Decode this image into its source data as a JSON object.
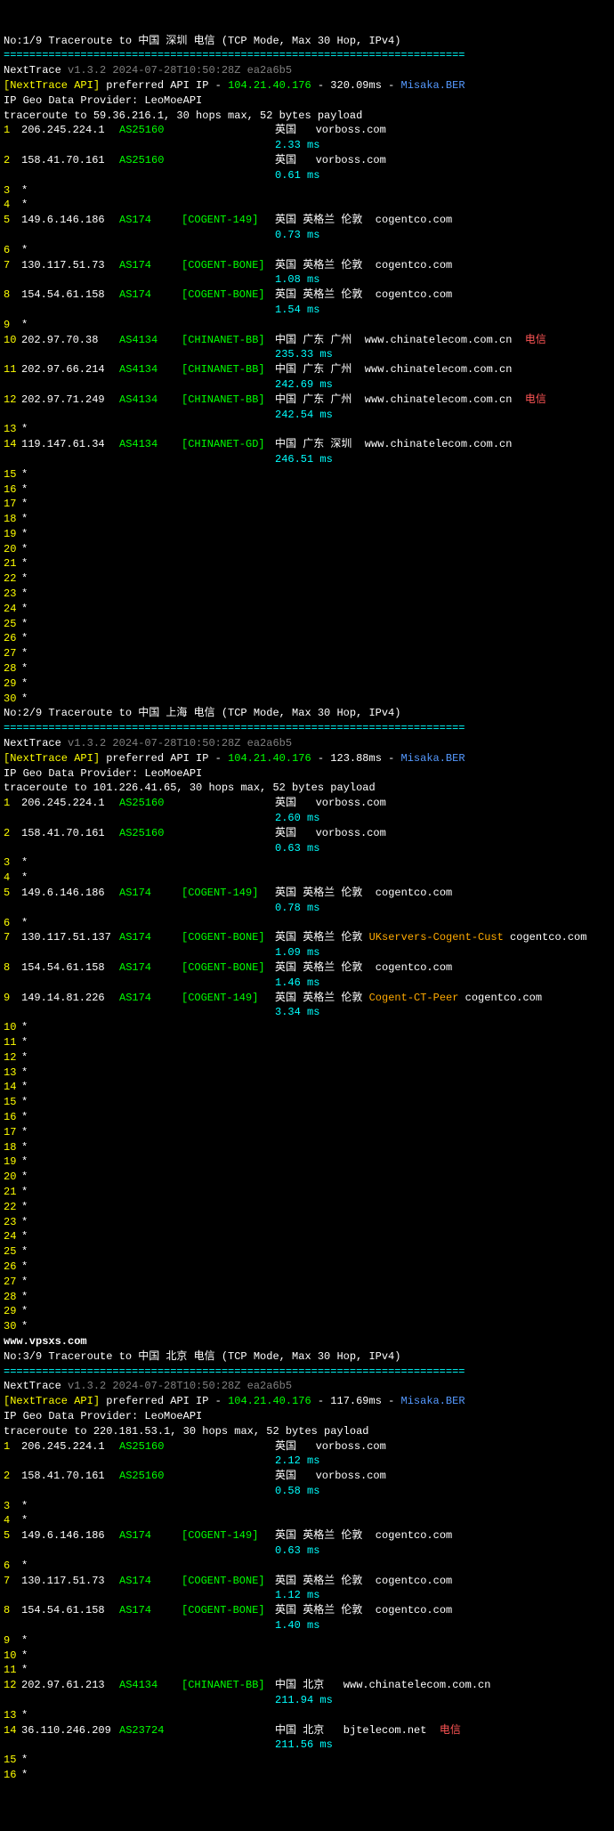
{
  "sections": [
    {
      "title": "No:1/9 Traceroute to 中国 深圳 电信 (TCP Mode, Max 30 Hop, IPv4)",
      "sep": "========================================================================",
      "nexttrace": "NextTrace",
      "ver": "v1.3.2 2024-07-28T10:50:28Z ea2a6b5",
      "api1": "[NextTrace API]",
      "api2": " preferred API IP - ",
      "ip": "104.21.40.176",
      "rtt": " - 320.09ms - ",
      "pop": "Misaka.BER",
      "geo": "IP Geo Data Provider: LeoMoeAPI",
      "trace": "traceroute to 59.36.216.1, 30 hops max, 52 bytes payload",
      "hops": [
        {
          "n": "1",
          "ip": "206.245.224.1",
          "as": "AS25160",
          "net": "",
          "loc": "英国  ",
          "host": " vorboss.com",
          "ms": "2.33 ms"
        },
        {
          "n": "2",
          "ip": "158.41.70.161",
          "as": "AS25160",
          "net": "",
          "loc": "英国  ",
          "host": " vorboss.com",
          "ms": "0.61 ms"
        },
        {
          "n": "3",
          "star": "*"
        },
        {
          "n": "4",
          "star": "*"
        },
        {
          "n": "5",
          "ip": "149.6.146.186",
          "as": "AS174",
          "net": "[COGENT-149]",
          "loc": "英国 英格兰 伦敦 ",
          "host": " cogentco.com",
          "ms": "0.73 ms"
        },
        {
          "n": "6",
          "star": "*"
        },
        {
          "n": "7",
          "ip": "130.117.51.73",
          "as": "AS174",
          "net": "[COGENT-BONE]",
          "loc": "英国 英格兰 伦敦 ",
          "host": " cogentco.com",
          "ms": "1.08 ms"
        },
        {
          "n": "8",
          "ip": "154.54.61.158",
          "as": "AS174",
          "net": "[COGENT-BONE]",
          "loc": "英国 英格兰 伦敦 ",
          "host": " cogentco.com",
          "ms": "1.54 ms"
        },
        {
          "n": "9",
          "star": "*"
        },
        {
          "n": "10",
          "ip": "202.97.70.38",
          "as": "AS4134",
          "net": "[CHINANET-BB]",
          "loc": "中国 广东 广州 ",
          "host": " www.chinatelecom.com.cn",
          "isp": "  电信",
          "ms": "235.33 ms"
        },
        {
          "n": "11",
          "ip": "202.97.66.214",
          "as": "AS4134",
          "net": "[CHINANET-BB]",
          "loc": "中国 广东 广州 ",
          "host": " www.chinatelecom.com.cn",
          "ms": "242.69 ms"
        },
        {
          "n": "12",
          "ip": "202.97.71.249",
          "as": "AS4134",
          "net": "[CHINANET-BB]",
          "loc": "中国 广东 广州 ",
          "host": " www.chinatelecom.com.cn",
          "isp": "  电信",
          "ms": "242.54 ms"
        },
        {
          "n": "13",
          "star": "*"
        },
        {
          "n": "14",
          "ip": "119.147.61.34",
          "as": "AS4134",
          "net": "[CHINANET-GD]",
          "loc": "中国 广东 深圳 ",
          "host": " www.chinatelecom.com.cn",
          "ms": "246.51 ms"
        },
        {
          "n": "15",
          "star": "*"
        },
        {
          "n": "16",
          "star": "*"
        },
        {
          "n": "17",
          "star": "*"
        },
        {
          "n": "18",
          "star": "*"
        },
        {
          "n": "19",
          "star": "*"
        },
        {
          "n": "20",
          "star": "*"
        },
        {
          "n": "21",
          "star": "*"
        },
        {
          "n": "22",
          "star": "*"
        },
        {
          "n": "23",
          "star": "*"
        },
        {
          "n": "24",
          "star": "*"
        },
        {
          "n": "25",
          "star": "*"
        },
        {
          "n": "26",
          "star": "*"
        },
        {
          "n": "27",
          "star": "*"
        },
        {
          "n": "28",
          "star": "*"
        },
        {
          "n": "29",
          "star": "*"
        },
        {
          "n": "30",
          "star": "*"
        }
      ]
    },
    {
      "title": "No:2/9 Traceroute to 中国 上海 电信 (TCP Mode, Max 30 Hop, IPv4)",
      "sep": "========================================================================",
      "nexttrace": "NextTrace",
      "ver": "v1.3.2 2024-07-28T10:50:28Z ea2a6b5",
      "api1": "[NextTrace API]",
      "api2": " preferred API IP - ",
      "ip": "104.21.40.176",
      "rtt": " - 123.88ms - ",
      "pop": "Misaka.BER",
      "geo": "IP Geo Data Provider: LeoMoeAPI",
      "trace": "traceroute to 101.226.41.65, 30 hops max, 52 bytes payload",
      "hops": [
        {
          "n": "1",
          "ip": "206.245.224.1",
          "as": "AS25160",
          "net": "",
          "loc": "英国  ",
          "host": " vorboss.com",
          "ms": "2.60 ms"
        },
        {
          "n": "2",
          "ip": "158.41.70.161",
          "as": "AS25160",
          "net": "",
          "loc": "英国  ",
          "host": " vorboss.com",
          "ms": "0.63 ms"
        },
        {
          "n": "3",
          "star": "*"
        },
        {
          "n": "4",
          "star": "*"
        },
        {
          "n": "5",
          "ip": "149.6.146.186",
          "as": "AS174",
          "net": "[COGENT-149]",
          "loc": "英国 英格兰 伦敦 ",
          "host": " cogentco.com",
          "ms": "0.78 ms"
        },
        {
          "n": "6",
          "star": "*"
        },
        {
          "n": "7",
          "ip": "130.117.51.137",
          "as": "AS174",
          "net": "[COGENT-BONE]",
          "loc": "英国 英格兰 伦敦 ",
          "host2": "UKservers-Cogent-Cust",
          "host": " cogentco.com",
          "ms": "1.09 ms"
        },
        {
          "n": "8",
          "ip": "154.54.61.158",
          "as": "AS174",
          "net": "[COGENT-BONE]",
          "loc": "英国 英格兰 伦敦 ",
          "host": " cogentco.com",
          "ms": "1.46 ms"
        },
        {
          "n": "9",
          "ip": "149.14.81.226",
          "as": "AS174",
          "net": "[COGENT-149]",
          "loc": "英国 英格兰 伦敦 ",
          "host2": "Cogent-CT-Peer",
          "host": " cogentco.com",
          "ms": "3.34 ms"
        },
        {
          "n": "10",
          "star": "*"
        },
        {
          "n": "11",
          "star": "*"
        },
        {
          "n": "12",
          "star": "*"
        },
        {
          "n": "13",
          "star": "*"
        },
        {
          "n": "14",
          "star": "*"
        },
        {
          "n": "15",
          "star": "*"
        },
        {
          "n": "16",
          "star": "*"
        },
        {
          "n": "17",
          "star": "*"
        },
        {
          "n": "18",
          "star": "*"
        },
        {
          "n": "19",
          "star": "*"
        },
        {
          "n": "20",
          "star": "*"
        },
        {
          "n": "21",
          "star": "*"
        },
        {
          "n": "22",
          "star": "*"
        },
        {
          "n": "23",
          "star": "*"
        },
        {
          "n": "24",
          "star": "*"
        },
        {
          "n": "25",
          "star": "*"
        },
        {
          "n": "26",
          "star": "*"
        },
        {
          "n": "27",
          "star": "*"
        },
        {
          "n": "28",
          "star": "*"
        },
        {
          "n": "29",
          "star": "*"
        },
        {
          "n": "30",
          "star": "*"
        }
      ],
      "watermark": "www.vpsxs.com"
    },
    {
      "title": "No:3/9 Traceroute to 中国 北京 电信 (TCP Mode, Max 30 Hop, IPv4)",
      "sep": "========================================================================",
      "nexttrace": "NextTrace",
      "ver": "v1.3.2 2024-07-28T10:50:28Z ea2a6b5",
      "api1": "[NextTrace API]",
      "api2": " preferred API IP - ",
      "ip": "104.21.40.176",
      "rtt": " - 117.69ms - ",
      "pop": "Misaka.BER",
      "geo": "IP Geo Data Provider: LeoMoeAPI",
      "trace": "traceroute to 220.181.53.1, 30 hops max, 52 bytes payload",
      "hops": [
        {
          "n": "1",
          "ip": "206.245.224.1",
          "as": "AS25160",
          "net": "",
          "loc": "英国  ",
          "host": " vorboss.com",
          "ms": "2.12 ms"
        },
        {
          "n": "2",
          "ip": "158.41.70.161",
          "as": "AS25160",
          "net": "",
          "loc": "英国  ",
          "host": " vorboss.com",
          "ms": "0.58 ms"
        },
        {
          "n": "3",
          "star": "*"
        },
        {
          "n": "4",
          "star": "*"
        },
        {
          "n": "5",
          "ip": "149.6.146.186",
          "as": "AS174",
          "net": "[COGENT-149]",
          "loc": "英国 英格兰 伦敦 ",
          "host": " cogentco.com",
          "ms": "0.63 ms"
        },
        {
          "n": "6",
          "star": "*"
        },
        {
          "n": "7",
          "ip": "130.117.51.73",
          "as": "AS174",
          "net": "[COGENT-BONE]",
          "loc": "英国 英格兰 伦敦 ",
          "host": " cogentco.com",
          "ms": "1.12 ms"
        },
        {
          "n": "8",
          "ip": "154.54.61.158",
          "as": "AS174",
          "net": "[COGENT-BONE]",
          "loc": "英国 英格兰 伦敦 ",
          "host": " cogentco.com",
          "ms": "1.40 ms"
        },
        {
          "n": "9",
          "star": "*"
        },
        {
          "n": "10",
          "star": "*"
        },
        {
          "n": "11",
          "star": "*"
        },
        {
          "n": "12",
          "ip": "202.97.61.213",
          "as": "AS4134",
          "net": "[CHINANET-BB]",
          "loc": "中国 北京  ",
          "host": " www.chinatelecom.com.cn",
          "ms": "211.94 ms"
        },
        {
          "n": "13",
          "star": "*"
        },
        {
          "n": "14",
          "ip": "36.110.246.209",
          "as": "AS23724",
          "net": "",
          "loc": "中国 北京  ",
          "host": " bjtelecom.net",
          "isp": "  电信",
          "ms": "211.56 ms"
        },
        {
          "n": "15",
          "star": "*"
        },
        {
          "n": "16",
          "star": "*"
        }
      ]
    }
  ]
}
